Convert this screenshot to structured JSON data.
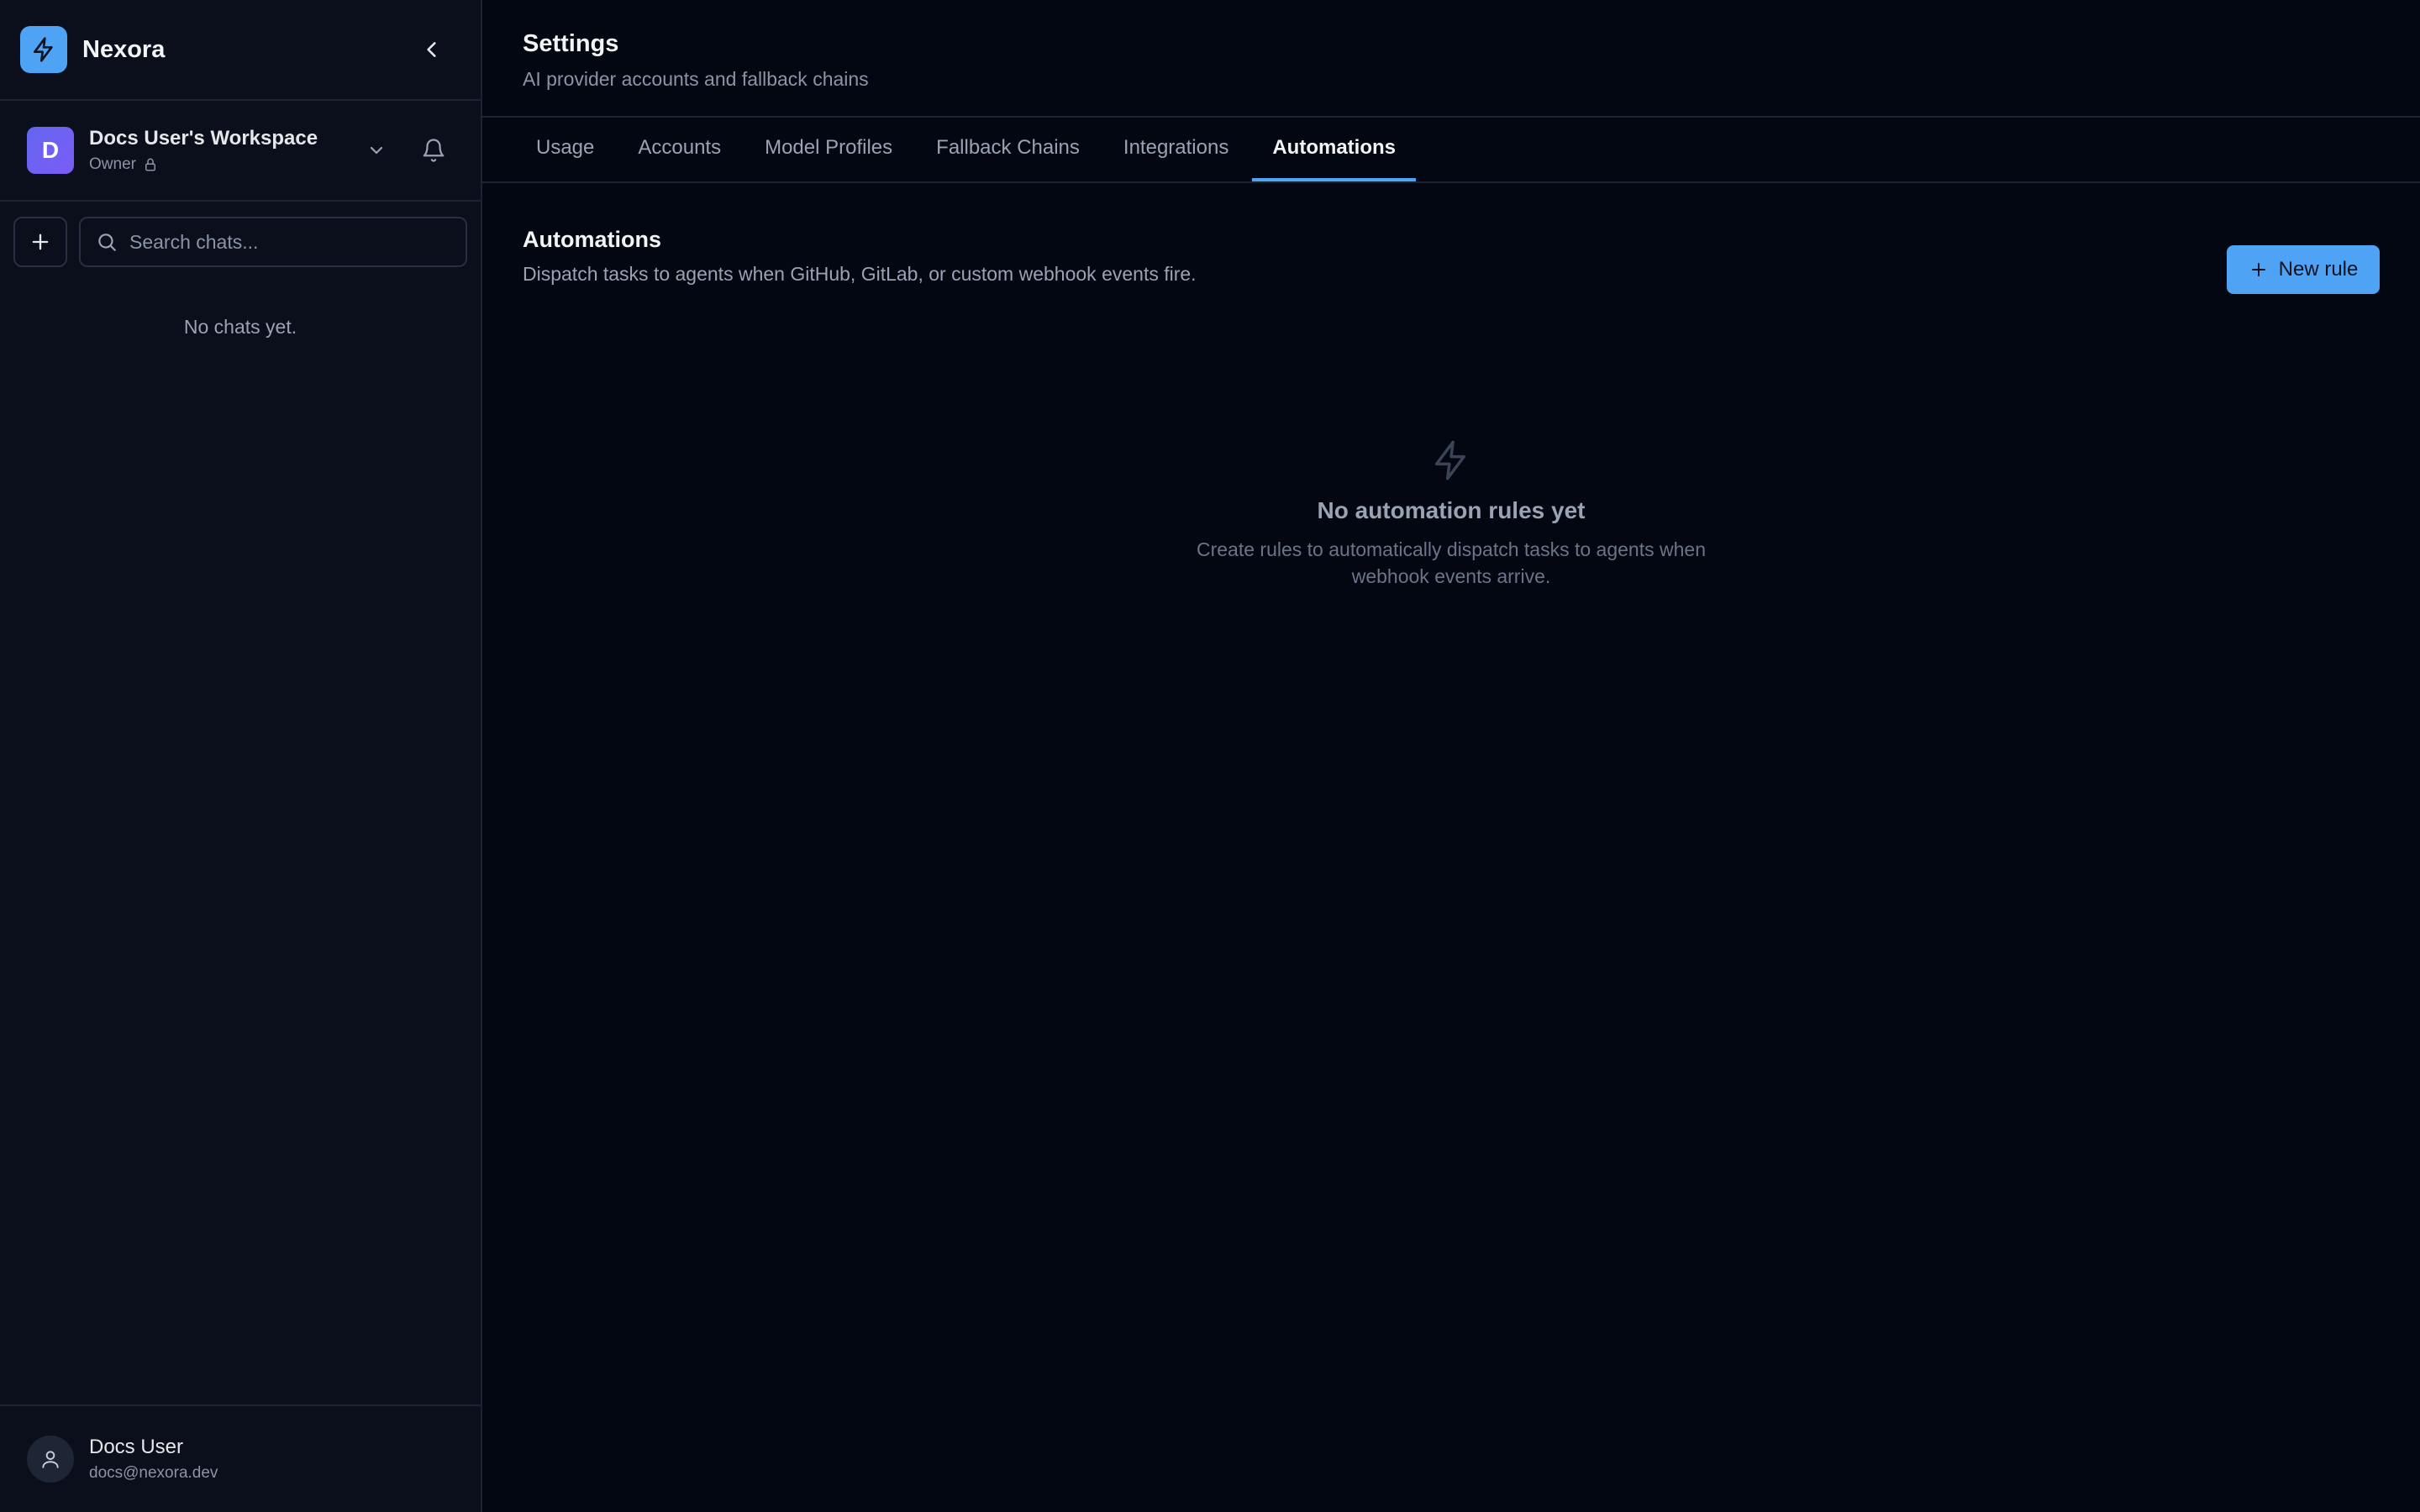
{
  "brand": {
    "name": "Nexora",
    "icon": "bolt-icon",
    "accent": "#4ea3f5"
  },
  "workspace": {
    "initial": "D",
    "name": "Docs User's Workspace",
    "role": "Owner"
  },
  "search": {
    "placeholder": "Search chats..."
  },
  "chats": {
    "empty_text": "No chats yet."
  },
  "user": {
    "name": "Docs User",
    "email": "docs@nexora.dev"
  },
  "header": {
    "title": "Settings",
    "subtitle": "AI provider accounts and fallback chains"
  },
  "tabs": [
    {
      "label": "Usage",
      "active": false
    },
    {
      "label": "Accounts",
      "active": false
    },
    {
      "label": "Model Profiles",
      "active": false
    },
    {
      "label": "Fallback Chains",
      "active": false
    },
    {
      "label": "Integrations",
      "active": false
    },
    {
      "label": "Automations",
      "active": true
    }
  ],
  "section": {
    "title": "Automations",
    "description": "Dispatch tasks to agents when GitHub, GitLab, or custom webhook events fire.",
    "new_rule_label": "New rule"
  },
  "empty_state": {
    "title": "No automation rules yet",
    "description": "Create rules to automatically dispatch tasks to agents when webhook events arrive."
  }
}
